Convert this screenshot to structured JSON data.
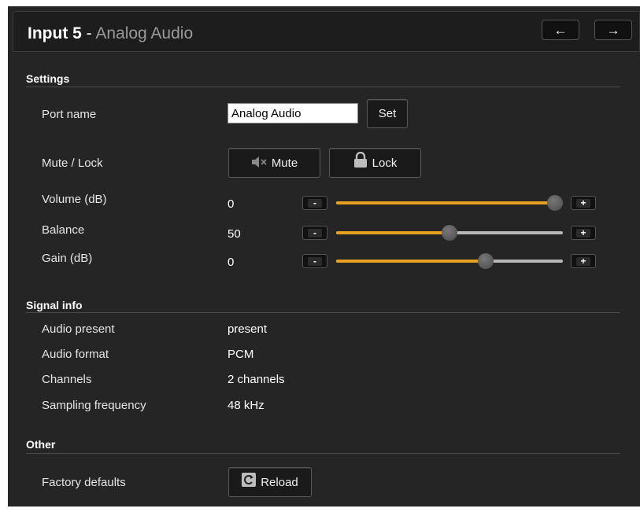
{
  "header": {
    "title_main": "Input 5",
    "title_sep": " - ",
    "title_sub": "Analog Audio",
    "prev_icon": "←",
    "next_icon": "→"
  },
  "settings": {
    "title": "Settings",
    "port_name_label": "Port name",
    "port_name_value": "Analog Audio",
    "set_label": "Set",
    "mute_lock_label": "Mute / Lock",
    "mute_label": "Mute",
    "lock_label": "Lock",
    "sliders": [
      {
        "label": "Volume (dB)",
        "value": "0",
        "fraction": 1.0
      },
      {
        "label": "Balance",
        "value": "50",
        "fraction": 0.5
      },
      {
        "label": "Gain (dB)",
        "value": "0",
        "fraction": 0.66
      }
    ],
    "minus_label": "-",
    "plus_label": "+"
  },
  "signal_info": {
    "title": "Signal info",
    "rows": [
      {
        "label": "Audio present",
        "value": "present"
      },
      {
        "label": "Audio format",
        "value": "PCM"
      },
      {
        "label": "Channels",
        "value": "2 channels"
      },
      {
        "label": "Sampling frequency",
        "value": "48 kHz"
      }
    ]
  },
  "other": {
    "title": "Other",
    "factory_label": "Factory defaults",
    "reload_label": "Reload"
  },
  "colors": {
    "accent": "#e8a020",
    "panel": "#252525"
  }
}
